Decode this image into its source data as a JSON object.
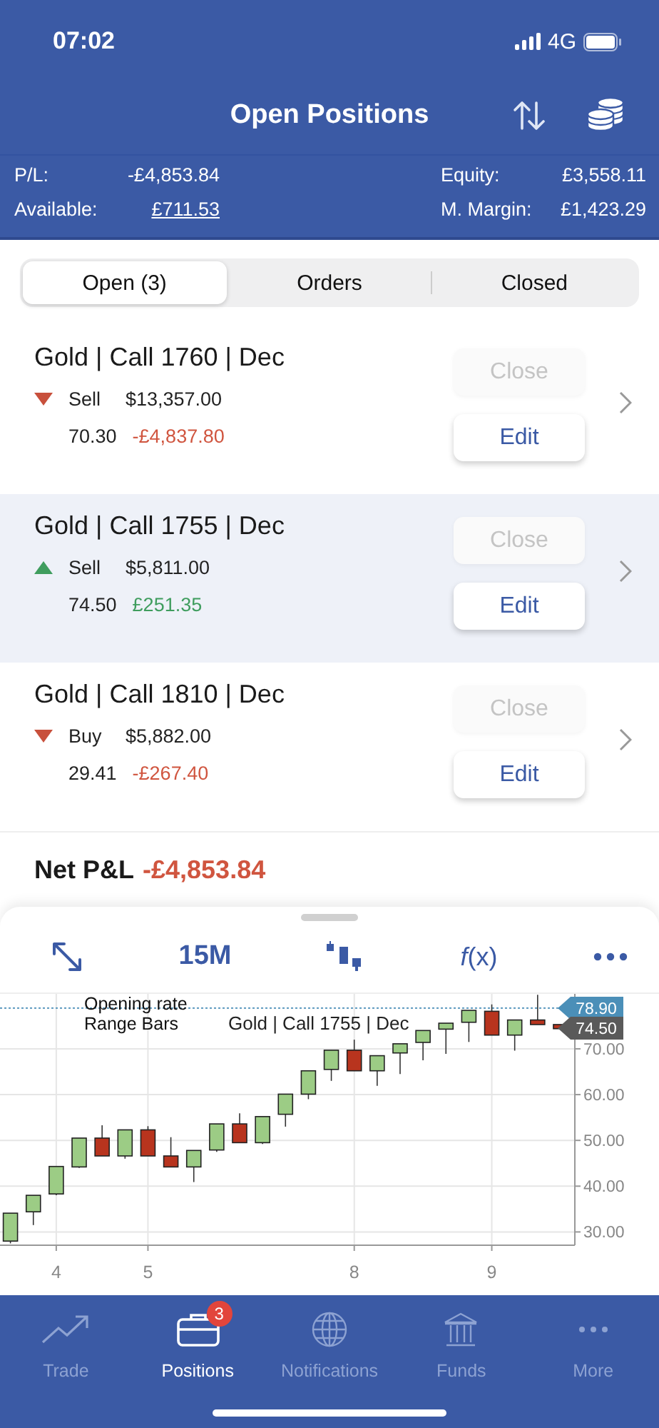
{
  "status_bar": {
    "time": "07:02",
    "network": "4G"
  },
  "header": {
    "title": "Open Positions"
  },
  "summary": [
    {
      "label": "P/L:",
      "value": "-£4,853.84",
      "link": false
    },
    {
      "label": "Equity:",
      "value": "£3,558.11",
      "link": false
    },
    {
      "label": "Available:",
      "value": "£711.53",
      "link": true
    },
    {
      "label": "M. Margin:",
      "value": "£1,423.29",
      "link": false
    }
  ],
  "tabs": [
    {
      "label": "Open (3)",
      "selected": true
    },
    {
      "label": "Orders",
      "selected": false
    },
    {
      "label": "Closed",
      "selected": false
    }
  ],
  "positions": [
    {
      "title": "Gold | Call 1760 | Dec",
      "rising": false,
      "side": "Sell",
      "amount": "$13,357.00",
      "price": "70.30",
      "pnl": "-£4,837.80",
      "selected": false,
      "buttons": [
        {
          "label": "Close",
          "disabled": true
        },
        {
          "label": "Edit",
          "disabled": false
        }
      ]
    },
    {
      "title": "Gold | Call 1755 | Dec",
      "rising": true,
      "side": "Sell",
      "amount": "$5,811.00",
      "price": "74.50",
      "pnl": "£251.35",
      "selected": true,
      "buttons": [
        {
          "label": "Close",
          "disabled": true
        },
        {
          "label": "Edit",
          "disabled": false
        }
      ]
    },
    {
      "title": "Gold | Call 1810 | Dec",
      "rising": false,
      "side": "Buy",
      "amount": "$5,882.00",
      "price": "29.41",
      "pnl": "-£267.40",
      "selected": false,
      "buttons": [
        {
          "label": "Close",
          "disabled": true
        },
        {
          "label": "Edit",
          "disabled": false
        }
      ]
    }
  ],
  "net": {
    "label": "Net P&L",
    "value": "-£4,853.84"
  },
  "chart_toolbar": {
    "interval": "15M",
    "functions": "*f*(x)"
  },
  "chart": {
    "legend": [
      "Opening rate",
      "Range Bars"
    ],
    "instrument": "Gold | Call 1755 | Dec",
    "tags": [
      {
        "label": "78.90",
        "color": "#4b8fb8"
      },
      {
        "label": "74.50",
        "color": "#5a5a5a"
      }
    ],
    "chart_data": {
      "type": "candlestick",
      "categories": [
        null,
        null,
        "4",
        null,
        null,
        null,
        "5",
        null,
        null,
        null,
        null,
        null,
        null,
        null,
        null,
        "8",
        null,
        null,
        null,
        null,
        null,
        "9",
        null,
        null,
        null
      ],
      "ohlc": [
        [
          28.0,
          34.1,
          27.5,
          34.1
        ],
        [
          34.4,
          38.0,
          31.5,
          38.0
        ],
        [
          38.3,
          44.3,
          38.0,
          44.3
        ],
        [
          44.2,
          50.5,
          44.0,
          50.5
        ],
        [
          50.5,
          53.3,
          46.6,
          46.6
        ],
        [
          46.6,
          52.3,
          46.0,
          52.3
        ],
        [
          52.3,
          53.1,
          46.6,
          46.6
        ],
        [
          46.6,
          50.7,
          44.2,
          44.2
        ],
        [
          44.2,
          47.8,
          40.9,
          47.8
        ],
        [
          47.9,
          53.6,
          47.5,
          53.6
        ],
        [
          53.6,
          55.9,
          49.5,
          49.5
        ],
        [
          49.5,
          55.2,
          49.2,
          55.2
        ],
        [
          55.7,
          60.1,
          53.0,
          60.1
        ],
        [
          60.1,
          65.2,
          59.0,
          65.2
        ],
        [
          65.5,
          69.7,
          63.0,
          69.7
        ],
        [
          69.7,
          72.0,
          65.2,
          65.2
        ],
        [
          65.2,
          68.5,
          61.9,
          68.5
        ],
        [
          69.1,
          71.1,
          64.5,
          71.1
        ],
        [
          71.4,
          74.0,
          67.5,
          74.0
        ],
        [
          74.3,
          75.6,
          68.9,
          75.6
        ],
        [
          75.8,
          78.4,
          71.5,
          78.4
        ],
        [
          78.2,
          79.7,
          73.0,
          73.0
        ],
        [
          73.0,
          76.3,
          69.6,
          76.3
        ],
        [
          76.3,
          81.8,
          75.3,
          75.3
        ],
        [
          75.3,
          75.3,
          74.4,
          74.4
        ]
      ],
      "ylim": [
        27.1,
        82
      ],
      "grid": true,
      "ref_lines": [
        {
          "axis": "y",
          "value": 78.9,
          "color": "#4b8fb8"
        }
      ],
      "yticks": [
        {
          "value": 30,
          "label": "30.00"
        },
        {
          "value": 40,
          "label": "40.00"
        },
        {
          "value": 50,
          "label": "50.00"
        },
        {
          "value": 60,
          "label": "60.00"
        },
        {
          "value": 70,
          "label": "70.00"
        }
      ]
    }
  },
  "nav": [
    {
      "kind": "trade",
      "label": "Trade",
      "selected": false
    },
    {
      "kind": "positions",
      "label": "Positions",
      "selected": true,
      "badge": "3"
    },
    {
      "kind": "notifications",
      "label": "Notifications",
      "selected": false
    },
    {
      "kind": "funds",
      "label": "Funds",
      "selected": false
    },
    {
      "kind": "more",
      "label": "More",
      "selected": false
    }
  ]
}
